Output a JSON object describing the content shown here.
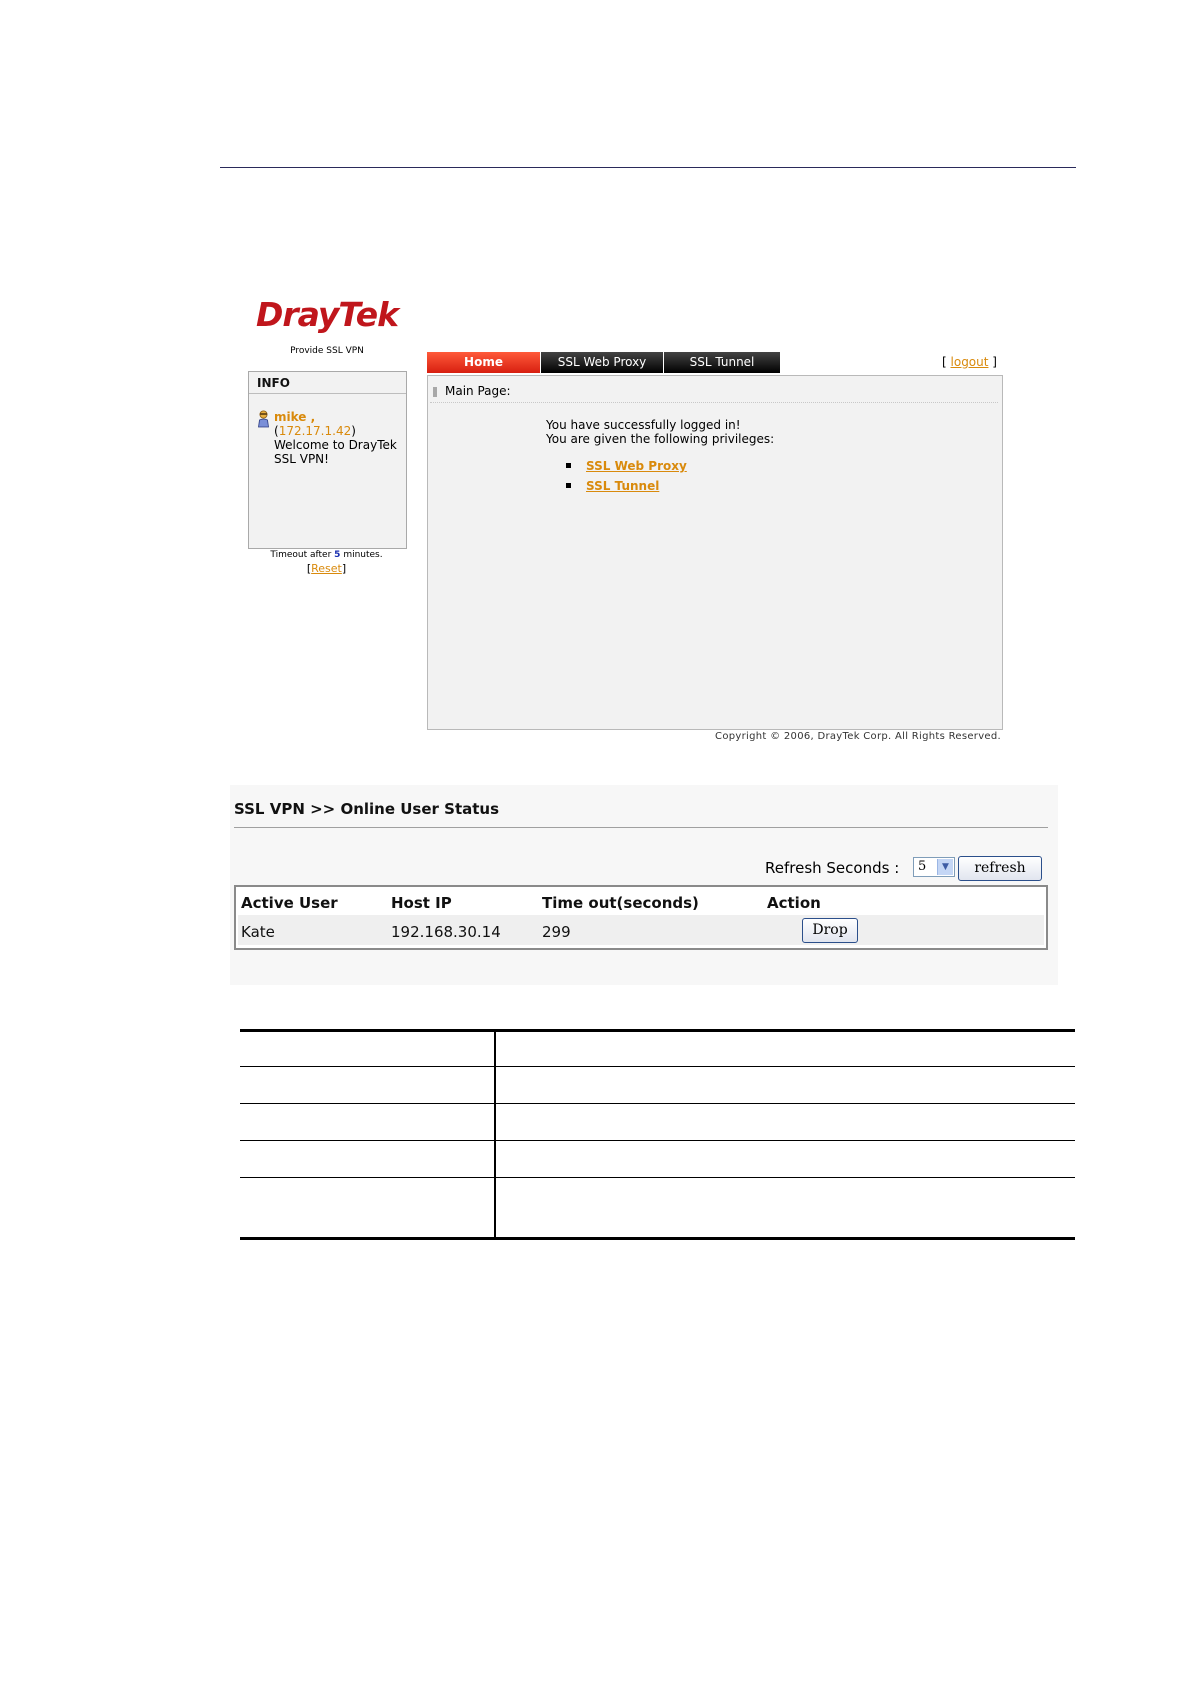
{
  "login_page": {
    "logo_text": "DrayTek",
    "tagline": "Provide SSL VPN",
    "info": {
      "heading": "INFO",
      "user_name": "mike ,",
      "ip_open": "(",
      "ip": "172.17.1.42",
      "ip_close": ")",
      "welcome": "Welcome to DrayTek SSL VPN!"
    },
    "timeout": {
      "prefix": "Timeout after",
      "minutes": "5",
      "suffix": "minutes."
    },
    "reset": {
      "open": "[",
      "label": "Reset",
      "close": "]"
    },
    "tabs": [
      {
        "label": "Home",
        "active": true
      },
      {
        "label": "SSL Web Proxy",
        "active": false
      },
      {
        "label": "SSL Tunnel",
        "active": false
      }
    ],
    "logout": {
      "open": "[",
      "label": "logout",
      "close": "]"
    },
    "main": {
      "title": "Main Page:",
      "line1": "You have successfully logged in!",
      "line2": "You are given the following privileges:",
      "privileges": [
        "SSL Web Proxy",
        "SSL Tunnel"
      ]
    },
    "copyright": "Copyright © 2006, DrayTek Corp. All Rights Reserved."
  },
  "online_status": {
    "title": "SSL VPN >> Online User Status",
    "refresh_label": "Refresh Seconds :",
    "refresh_value": "5",
    "refresh_button": "refresh",
    "columns": [
      "Active User",
      "Host IP",
      "Time out(seconds)",
      "Action"
    ],
    "rows": [
      {
        "user": "Kate",
        "host_ip": "192.168.30.14",
        "timeout": "299",
        "action": "Drop"
      }
    ]
  },
  "colors": {
    "brand_red": "#c0161c",
    "link_orange": "#d98a0c",
    "tab_active": "#d71f10",
    "tab_inactive": "#000000"
  }
}
